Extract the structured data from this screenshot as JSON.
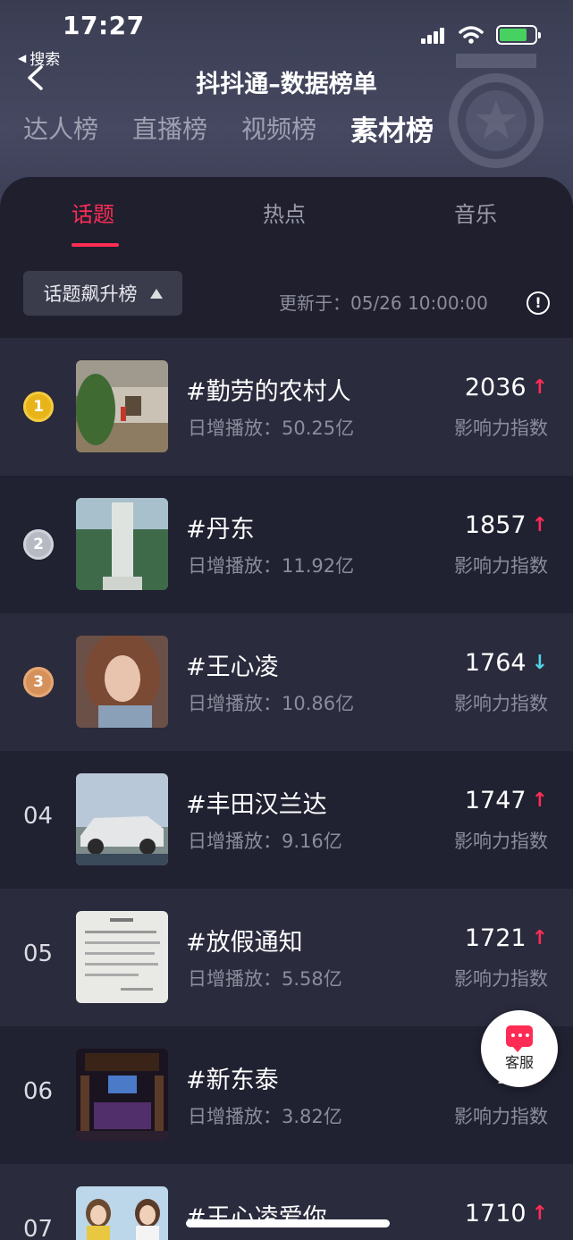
{
  "status_bar": {
    "time": "17:27",
    "back_app": "搜索"
  },
  "header": {
    "title": "抖抖通–数据榜单"
  },
  "main_tabs": [
    {
      "label": "达人榜",
      "active": false
    },
    {
      "label": "直播榜",
      "active": false
    },
    {
      "label": "视频榜",
      "active": false
    },
    {
      "label": "素材榜",
      "active": true
    }
  ],
  "sub_tabs": [
    {
      "label": "话题",
      "active": true
    },
    {
      "label": "热点",
      "active": false
    },
    {
      "label": "音乐",
      "active": false
    }
  ],
  "filter": {
    "selected": "话题飙升榜"
  },
  "update_time": "更新于：05/26 10:00:00",
  "rank_list": [
    {
      "rank": "1",
      "medal": "gold",
      "topic": "#勤劳的农村人",
      "plays": "日增播放：50.25亿",
      "score": "2036",
      "trend": "up",
      "score_label": "影响力指数"
    },
    {
      "rank": "2",
      "medal": "silver",
      "topic": "#丹东",
      "plays": "日增播放：11.92亿",
      "score": "1857",
      "trend": "up",
      "score_label": "影响力指数"
    },
    {
      "rank": "3",
      "medal": "bronze",
      "topic": "#王心凌",
      "plays": "日增播放：10.86亿",
      "score": "1764",
      "trend": "down",
      "score_label": "影响力指数"
    },
    {
      "rank": "04",
      "medal": "",
      "topic": "#丰田汉兰达",
      "plays": "日增播放：9.16亿",
      "score": "1747",
      "trend": "up",
      "score_label": "影响力指数"
    },
    {
      "rank": "05",
      "medal": "",
      "topic": "#放假通知",
      "plays": "日增播放：5.58亿",
      "score": "1721",
      "trend": "up",
      "score_label": "影响力指数"
    },
    {
      "rank": "06",
      "medal": "",
      "topic": "#新东泰",
      "plays": "日增播放：3.82亿",
      "score": "17",
      "trend": "up",
      "score_label": "影响力指数"
    },
    {
      "rank": "07",
      "medal": "",
      "topic": "#王心凌爱你",
      "plays": "",
      "score": "1710",
      "trend": "up",
      "score_label": ""
    }
  ],
  "customer_service": {
    "label": "客服"
  },
  "colors": {
    "accent": "#fe2c55",
    "down": "#4fd5e6",
    "panel": "#1f1f2e"
  }
}
